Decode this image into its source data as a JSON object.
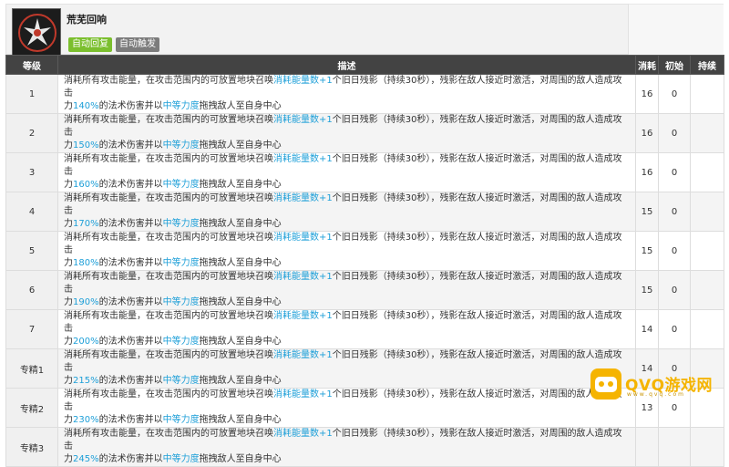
{
  "skill": {
    "name": "荒芜回响",
    "tags": {
      "recovery": "自动回复",
      "trigger": "自动触发"
    },
    "icon": "skill-icon"
  },
  "table": {
    "headers": {
      "level": "等级",
      "desc": "描述",
      "cost": "消耗",
      "init": "初始",
      "duration": "持续"
    },
    "rows": [
      {
        "level": "1",
        "pct": "140%",
        "cost": "16",
        "init": "0",
        "duration": ""
      },
      {
        "level": "2",
        "pct": "150%",
        "cost": "16",
        "init": "0",
        "duration": ""
      },
      {
        "level": "3",
        "pct": "160%",
        "cost": "16",
        "init": "0",
        "duration": ""
      },
      {
        "level": "4",
        "pct": "170%",
        "cost": "15",
        "init": "0",
        "duration": ""
      },
      {
        "level": "5",
        "pct": "180%",
        "cost": "15",
        "init": "0",
        "duration": ""
      },
      {
        "level": "6",
        "pct": "190%",
        "cost": "15",
        "init": "0",
        "duration": ""
      },
      {
        "level": "7",
        "pct": "200%",
        "cost": "14",
        "init": "0",
        "duration": ""
      },
      {
        "level": "专精1",
        "pct": "215%",
        "cost": "14",
        "init": "0",
        "duration": ""
      },
      {
        "level": "专精2",
        "pct": "230%",
        "cost": "13",
        "init": "0",
        "duration": ""
      },
      {
        "level": "专精3",
        "pct": "245%",
        "cost": "",
        "init": "",
        "duration": ""
      }
    ],
    "desc_parts": {
      "p1": "消耗所有攻击能量，在攻击范围内的可放置地块召唤",
      "hl1": "消耗能量数+1",
      "p2": "个旧日残影（持续30秒），残影在敌人接近时激活，对周围的敌人造成攻击",
      "p3": "力",
      "p4": "的法术伤害并以",
      "hl2": "中等力度",
      "p5": "拖拽敌人至自身中心"
    }
  },
  "watermark": {
    "text": "QVQ游戏网",
    "sub": "www.qvq.com"
  },
  "colors": {
    "header_bg": "#434343",
    "highlight": "#1d9fd8",
    "tag_green": "#7bbf2e",
    "tag_gray": "#7c7c7c"
  }
}
